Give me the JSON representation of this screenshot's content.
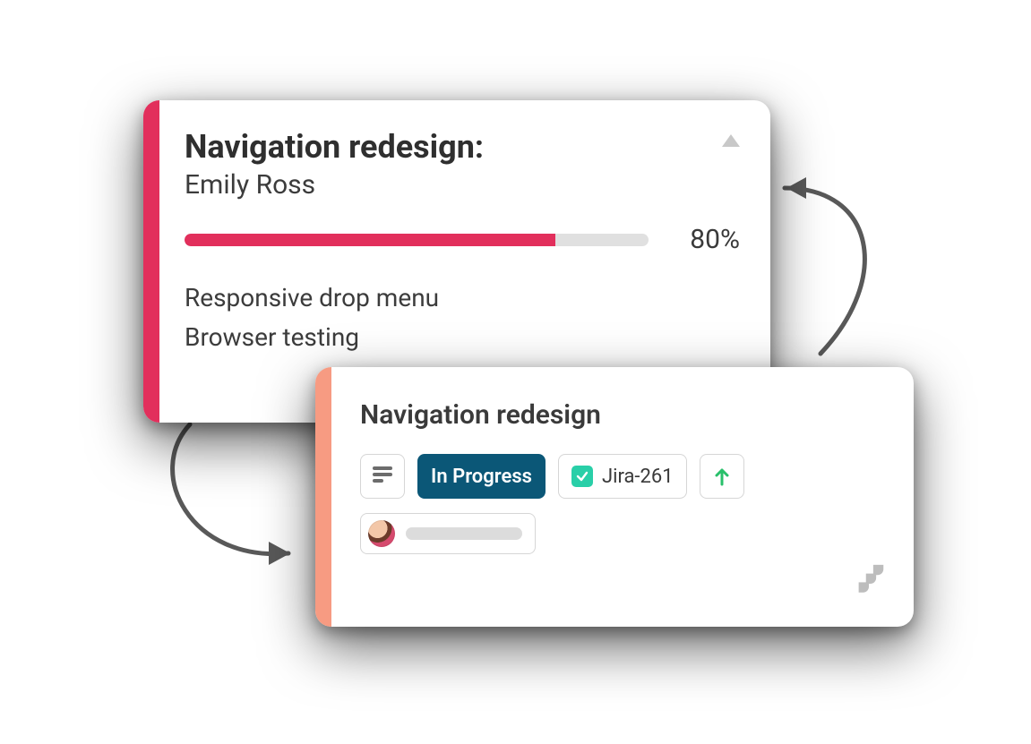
{
  "colors": {
    "card1_accent": "#e22f5c",
    "card2_accent": "#f79b82",
    "status_bg": "#0b5777",
    "tick_bg": "#29cfa8",
    "priority_arrow": "#29c06b",
    "arrow_stroke": "#595959"
  },
  "card1": {
    "title": "Navigation redesign:",
    "assignee": "Emily Ross",
    "progress_pct": 80,
    "progress_label": "80%",
    "tasks": [
      "Responsive drop menu",
      "Browser testing"
    ]
  },
  "card2": {
    "title": "Navigation redesign",
    "status_label": "In Progress",
    "jira_label": "Jira-261"
  }
}
